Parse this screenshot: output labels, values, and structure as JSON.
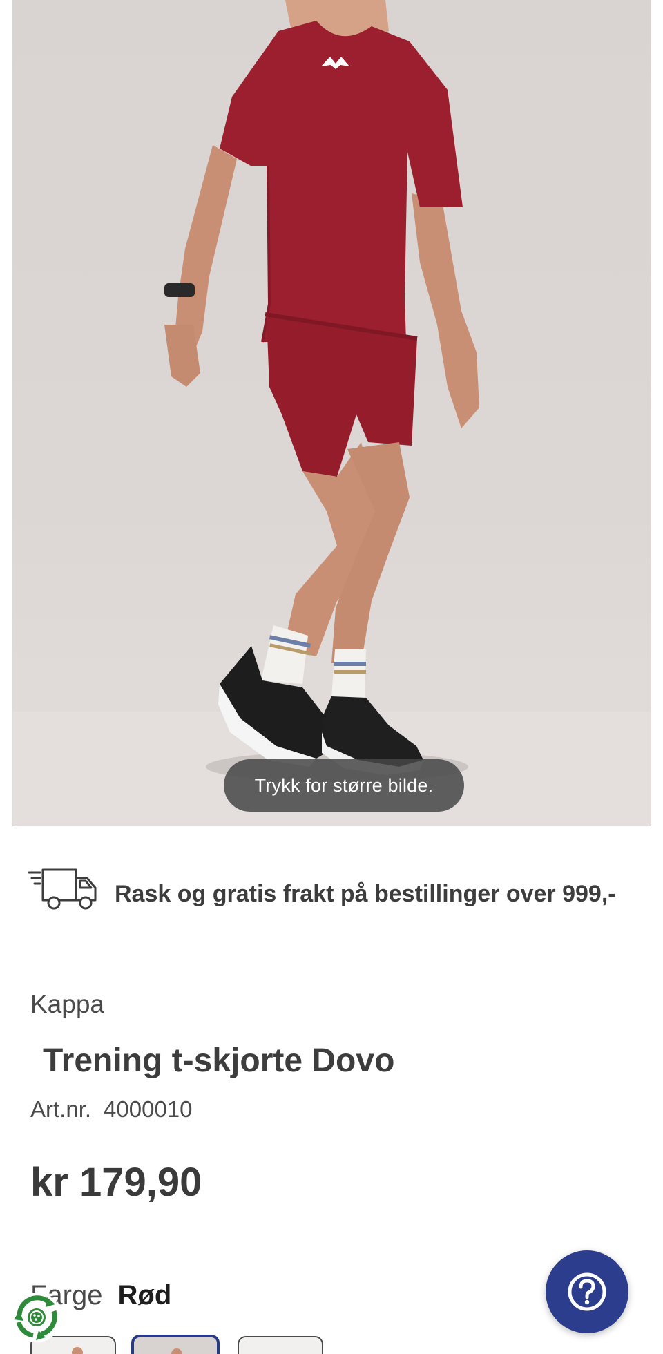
{
  "product_image": {
    "zoom_hint": "Trykk for større bilde."
  },
  "shipping": {
    "icon": "delivery-truck-icon",
    "text": "Rask og gratis frakt på bestillinger over 999,-"
  },
  "product": {
    "brand": "Kappa",
    "title": "Trening t-skjorte Dovo",
    "art_label": "Art.nr.",
    "art_number": "4000010",
    "price": "kr 179,90",
    "color_label": "Farge",
    "color_value": "Rød"
  },
  "help": {
    "icon": "question-mark-icon"
  },
  "eco_badge": {
    "icon": "recycle-badge-icon"
  },
  "colors": {
    "brand_blue": "#2b3d8c",
    "garment_red": "#9b1f2e",
    "text_dark": "#3d3d3d"
  }
}
